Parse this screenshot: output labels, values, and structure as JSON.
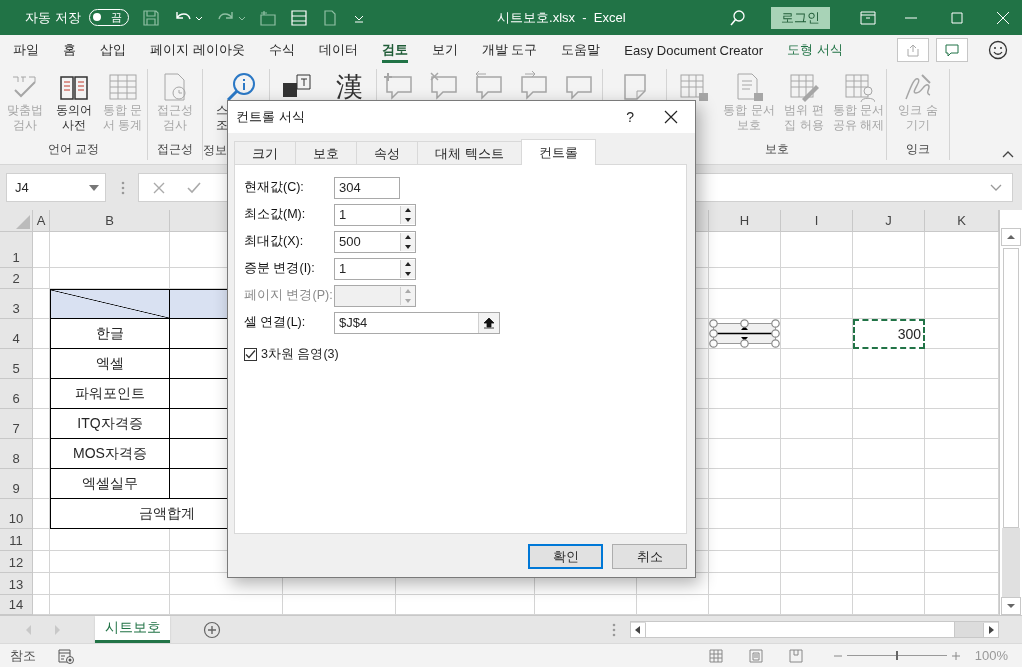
{
  "title_bar": {
    "autosave_label": "자동 저장",
    "autosave_on": false,
    "autosave_state": "끔",
    "title": "시트보호.xlsx  -  Excel",
    "sign_in": "로그인"
  },
  "ribbon_tabs": [
    {
      "label": "파일",
      "selected": false,
      "kind": "standard"
    },
    {
      "label": "홈",
      "selected": false,
      "kind": "standard"
    },
    {
      "label": "삽입",
      "selected": false,
      "kind": "standard"
    },
    {
      "label": "페이지 레이아웃",
      "selected": false,
      "kind": "standard"
    },
    {
      "label": "수식",
      "selected": false,
      "kind": "standard"
    },
    {
      "label": "데이터",
      "selected": false,
      "kind": "standard"
    },
    {
      "label": "검토",
      "selected": true,
      "kind": "standard"
    },
    {
      "label": "보기",
      "selected": false,
      "kind": "standard"
    },
    {
      "label": "개발 도구",
      "selected": false,
      "kind": "standard"
    },
    {
      "label": "도움말",
      "selected": false,
      "kind": "standard"
    },
    {
      "label": "Easy Document Creator",
      "selected": false,
      "kind": "standard"
    },
    {
      "label": "도형 서식",
      "selected": false,
      "kind": "contextual"
    }
  ],
  "ribbon_groups": [
    {
      "label": "언어 교정",
      "buttons": [
        {
          "label": [
            "맞춤법",
            "검사"
          ],
          "disabled": true
        },
        {
          "label": [
            "동의어",
            "사전"
          ],
          "disabled": false
        },
        {
          "label": [
            "통합 문",
            "서 통계"
          ],
          "disabled": true
        }
      ]
    },
    {
      "label": "접근성",
      "buttons": [
        {
          "label": [
            "접근성",
            "검사"
          ],
          "disabled": true
        }
      ]
    },
    {
      "label": "정보",
      "buttons": [
        {
          "label": [
            "스",
            "조"
          ],
          "disabled": false
        }
      ]
    },
    {
      "buttons": [
        {
          "disabled": false
        },
        {
          "glyph": "漢",
          "disabled": false
        }
      ]
    },
    {
      "buttons": [
        {
          "disabled": true
        },
        {
          "disabled": true
        },
        {
          "disabled": true
        },
        {
          "disabled": true
        },
        {
          "disabled": true
        }
      ]
    },
    {
      "buttons": [
        {
          "disabled": true
        }
      ]
    },
    {
      "label": "보호",
      "buttons": [
        {
          "disabled": true
        },
        {
          "label": [
            "통합 문서",
            "보호"
          ],
          "disabled": true
        },
        {
          "label": [
            "범위 편",
            "집 허용"
          ],
          "disabled": true
        },
        {
          "label": [
            "통합 문서",
            "공유 해제"
          ],
          "disabled": true
        }
      ]
    },
    {
      "label": "잉크",
      "buttons": [
        {
          "label": [
            "잉크 숨",
            "기기"
          ],
          "disabled": true
        }
      ]
    }
  ],
  "formula_bar": {
    "name_box": "J4"
  },
  "sheet": {
    "column_headers": [
      "A",
      "B",
      "H",
      "I",
      "J",
      "K"
    ],
    "rows": [
      {
        "number": "1",
        "kind": "blank"
      },
      {
        "number": "2",
        "kind": "blank"
      },
      {
        "number": "3",
        "kind": "header"
      },
      {
        "number": "4",
        "kind": "item",
        "item": "한글",
        "column_j": "300",
        "column_j_marquee": true
      },
      {
        "number": "5",
        "kind": "item",
        "item": "엑셀"
      },
      {
        "number": "6",
        "kind": "item",
        "item": "파워포인트"
      },
      {
        "number": "7",
        "kind": "item",
        "item": "ITQ자격증"
      },
      {
        "number": "8",
        "kind": "item",
        "item": "MOS자격증"
      },
      {
        "number": "9",
        "kind": "item",
        "item": "엑셀실무"
      },
      {
        "number": "10",
        "kind": "total",
        "item": "금액합계"
      },
      {
        "number": "11",
        "kind": "blank"
      },
      {
        "number": "12",
        "kind": "blank"
      },
      {
        "number": "13",
        "kind": "blank"
      },
      {
        "number": "14",
        "kind": "blank"
      }
    ]
  },
  "sheet_tabs": [
    {
      "label": "시트보호",
      "selected": true
    }
  ],
  "status_bar": {
    "mode": "참조",
    "zoom_slider": {
      "level": 0.5
    },
    "zoom": "100%"
  },
  "dialog": {
    "title": "컨트롤 서식",
    "help": "?",
    "tabs": [
      {
        "label": "크기",
        "selected": false
      },
      {
        "label": "보호",
        "selected": false
      },
      {
        "label": "속성",
        "selected": false
      },
      {
        "label": "대체 텍스트",
        "selected": false
      },
      {
        "label": "컨트롤",
        "selected": true
      }
    ],
    "fields": [
      {
        "label": "현재값(C):",
        "value": "304",
        "kind": "text",
        "disabled": false
      },
      {
        "label": "최소값(M):",
        "value": "1",
        "kind": "spin",
        "disabled": false
      },
      {
        "label": "최대값(X):",
        "value": "500",
        "kind": "spin",
        "disabled": false
      },
      {
        "label": "증분 변경(I):",
        "value": "1",
        "kind": "spin",
        "disabled": false
      },
      {
        "label": "페이지 변경(P):",
        "kind": "spin",
        "disabled": true
      },
      {
        "label": "셀 연결(L):",
        "value": "$J$4",
        "kind": "reference",
        "disabled": false
      }
    ],
    "checkbox": {
      "label": "3차원 음영(3)",
      "checked": true
    },
    "buttons": [
      {
        "label": "확인",
        "default": true
      },
      {
        "label": "취소",
        "default": false
      }
    ]
  }
}
